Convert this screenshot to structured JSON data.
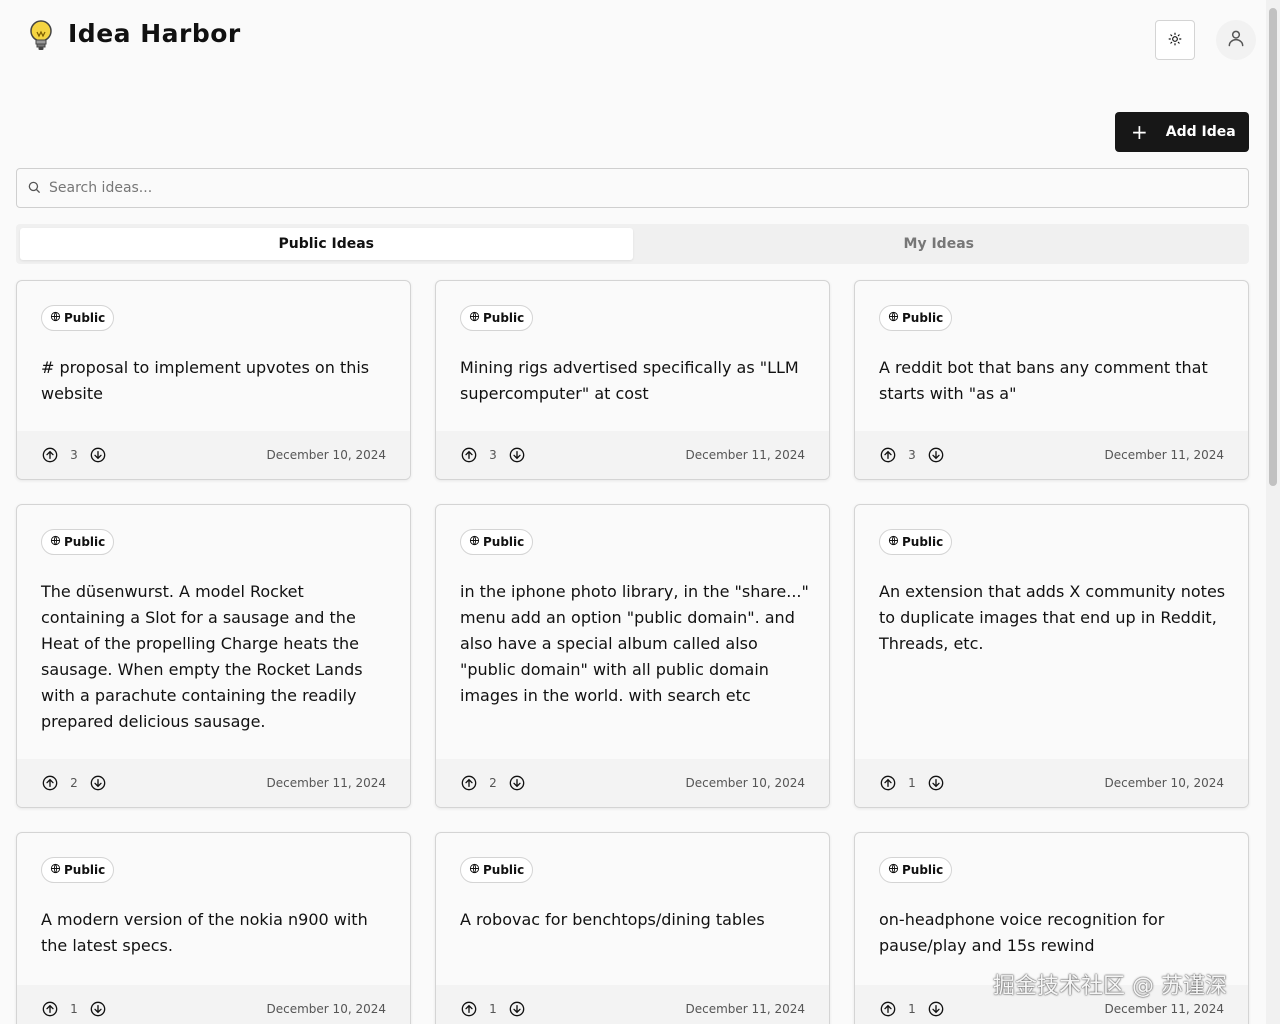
{
  "header": {
    "title": "Idea Harbor",
    "logo_icon": "lightbulb-icon",
    "theme_icon": "sun-icon",
    "user_icon": "user-icon"
  },
  "toolbar": {
    "add_label": "Add Idea"
  },
  "search": {
    "placeholder": "Search ideas..."
  },
  "tabs": [
    {
      "label": "Public Ideas",
      "active": true
    },
    {
      "label": "My Ideas",
      "active": false
    }
  ],
  "cards": [
    {
      "badge": "Public",
      "text": "# proposal to implement upvotes on this website",
      "votes": "3",
      "date": "December 10, 2024"
    },
    {
      "badge": "Public",
      "text": "Mining rigs advertised specifically as \"LLM supercomputer\" at cost",
      "votes": "3",
      "date": "December 11, 2024"
    },
    {
      "badge": "Public",
      "text": "A reddit bot that bans any comment that starts with \"as a\"",
      "votes": "3",
      "date": "December 11, 2024"
    },
    {
      "badge": "Public",
      "text": "The düsenwurst. A model Rocket containing a Slot for a sausage and the Heat of the propelling Charge heats the sausage. When empty the Rocket Lands with a parachute containing the readily prepared delicious sausage.",
      "votes": "2",
      "date": "December 11, 2024"
    },
    {
      "badge": "Public",
      "text": "in the iphone photo library, in the \"share...\" menu add an option \"public domain\". and also have a special album called also \"public domain\" with all public domain images in the world. with search etc",
      "votes": "2",
      "date": "December 10, 2024"
    },
    {
      "badge": "Public",
      "text": "An extension that adds X community notes to duplicate images that end up in Reddit, Threads, etc.",
      "votes": "1",
      "date": "December 10, 2024"
    },
    {
      "badge": "Public",
      "text": "A modern version of the nokia n900 with the latest specs.",
      "votes": "1",
      "date": "December 10, 2024"
    },
    {
      "badge": "Public",
      "text": "A robovac for benchtops/dining tables",
      "votes": "1",
      "date": "December 11, 2024"
    },
    {
      "badge": "Public",
      "text": "on-headphone voice recognition for pause/play and 15s rewind",
      "votes": "1",
      "date": "December 11, 2024"
    }
  ],
  "watermark": "掘金技术社区 @ 苏谨深"
}
